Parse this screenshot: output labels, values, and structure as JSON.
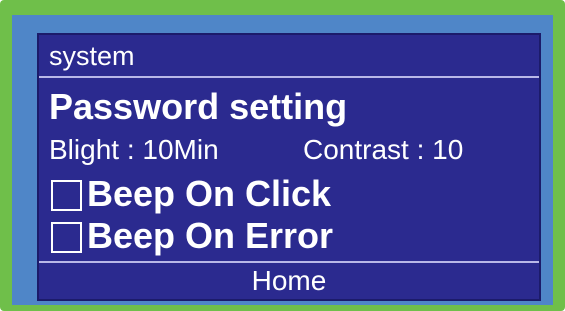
{
  "screen": {
    "title": "system",
    "password_setting": "Password setting",
    "blight": "Blight : 10Min",
    "contrast": "Contrast : 10",
    "options": [
      {
        "label": "Beep On Click",
        "checked": false
      },
      {
        "label": "Beep On Error",
        "checked": false
      }
    ],
    "home": "Home"
  },
  "colors": {
    "outer_bezel": "#6fbf4a",
    "inner_bezel": "#4f86c8",
    "screen_bg": "#2b2a8f",
    "text": "#ffffff"
  }
}
